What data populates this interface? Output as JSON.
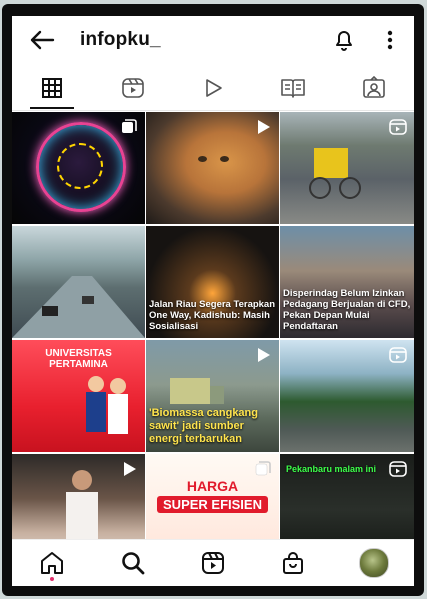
{
  "header": {
    "username": "infopku_",
    "icons": [
      "back-arrow-icon",
      "bell-icon",
      "more-vertical-icon"
    ]
  },
  "tabs": [
    {
      "name": "grid",
      "icon": "grid-icon",
      "active": true
    },
    {
      "name": "reels",
      "icon": "reels-icon",
      "active": false
    },
    {
      "name": "videos",
      "icon": "play-icon",
      "active": false
    },
    {
      "name": "guides",
      "icon": "guide-icon",
      "active": false
    },
    {
      "name": "tagged",
      "icon": "tagged-icon",
      "active": false
    }
  ],
  "posts": [
    {
      "type": "carousel",
      "caption": ""
    },
    {
      "type": "video",
      "caption": ""
    },
    {
      "type": "reel",
      "caption": ""
    },
    {
      "type": "photo",
      "caption": ""
    },
    {
      "type": "photo",
      "caption": "Jalan Riau Segera Terapkan One Way, Kadishub: Masih Sosialisasi"
    },
    {
      "type": "photo",
      "caption": "Disperindag Belum Izinkan Pedagang Berjualan di CFD, Pekan Depan Mulai Pendaftaran"
    },
    {
      "type": "photo",
      "caption": "",
      "title": "UNIVERSITAS PERTAMINA"
    },
    {
      "type": "video",
      "caption": "'Biomassa cangkang sawit' jadi sumber energi terbarukan"
    },
    {
      "type": "reel",
      "caption": ""
    },
    {
      "type": "video",
      "caption": ""
    },
    {
      "type": "carousel",
      "caption": "",
      "title": "HARGA",
      "subtitle": "SUPER EFISIEN"
    },
    {
      "type": "reel",
      "caption": "",
      "overlay": "Pekanbaru malam ini"
    }
  ],
  "bottom_nav": [
    {
      "name": "home",
      "icon": "home-icon",
      "active": true
    },
    {
      "name": "search",
      "icon": "search-icon",
      "active": false
    },
    {
      "name": "reels",
      "icon": "reels-icon",
      "active": false
    },
    {
      "name": "shop",
      "icon": "shop-icon",
      "active": false
    },
    {
      "name": "profile",
      "icon": "avatar",
      "active": false
    }
  ],
  "colors": {
    "accent_red": "#e11b2c",
    "activity_dot": "#e1306c",
    "text": "#111111"
  }
}
